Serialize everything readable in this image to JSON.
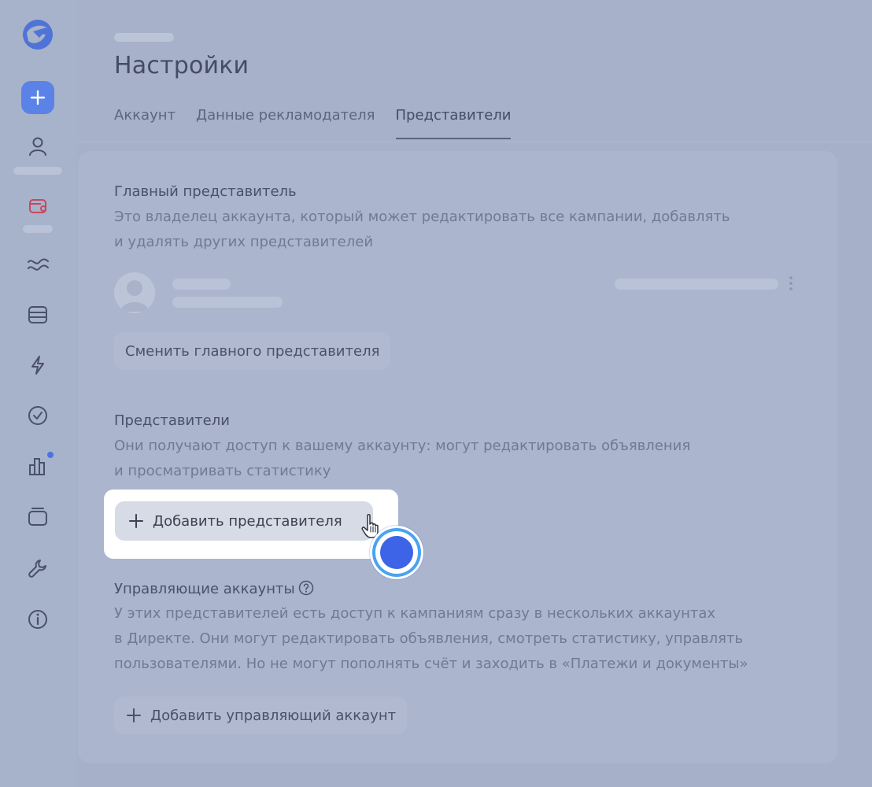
{
  "header": {
    "title": "Настройки",
    "tabs": [
      {
        "label": "Аккаунт",
        "active": false
      },
      {
        "label": "Данные рекламодателя",
        "active": false
      },
      {
        "label": "Представители",
        "active": true
      }
    ]
  },
  "sidebar": {
    "icons": [
      "logo-icon",
      "add-icon",
      "user-icon",
      "wallet-icon",
      "waves-icon",
      "database-icon",
      "lightning-icon",
      "check-circle-icon",
      "bar-chart-icon",
      "cards-icon",
      "wrench-icon",
      "info-icon"
    ],
    "accent_color": "#5a82e7",
    "alert_color": "#c8485c"
  },
  "main_rep": {
    "title": "Главный представитель",
    "desc_line1": "Это владелец аккаунта, который может редактировать все кампании, добавлять",
    "desc_line2": "и удалять других представителей",
    "change_button": "Сменить главного представителя"
  },
  "reps": {
    "title": "Представители",
    "desc_line1": "Они получают доступ к вашему аккаунту: могут редактировать объявления",
    "desc_line2": "и просматривать статистику",
    "add_button": "Добавить представителя"
  },
  "managing": {
    "title": "Управляющие аккаунты",
    "desc_line1": "У этих представителей есть доступ к кампаниям сразу в нескольких аккаунтах",
    "desc_line2": "в Директе. Они могут редактировать объявления, смотреть статистику, управлять",
    "desc_line3": "пользователями. Но не могут пополнять счёт и заходить в «Платежи и документы»",
    "add_button": "Добавить управляющий аккаунт"
  },
  "click_indicator_color": "#3d63e6"
}
